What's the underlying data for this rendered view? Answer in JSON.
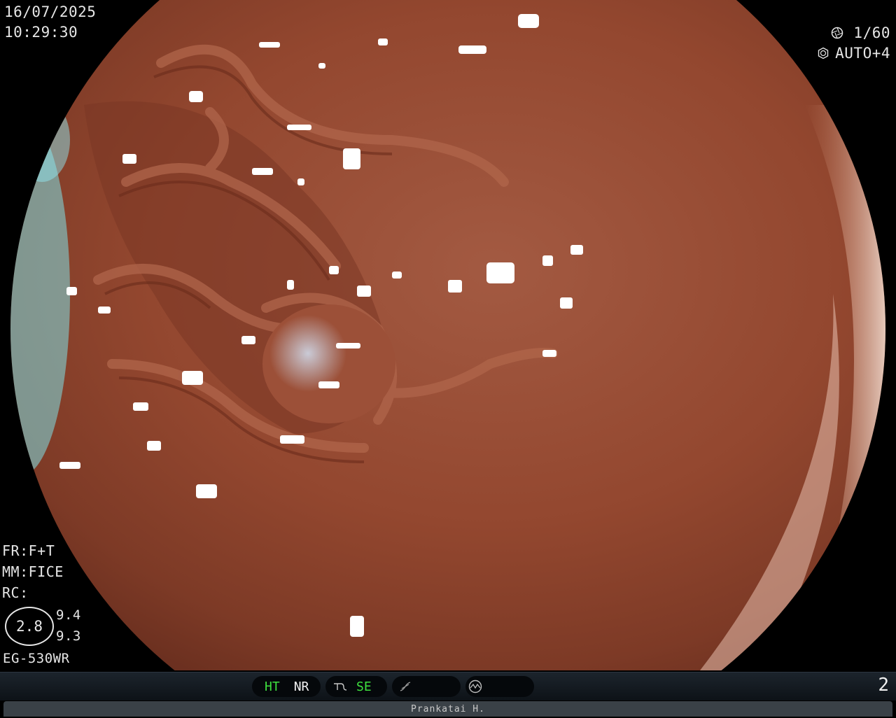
{
  "datetime": {
    "date": "16/07/2025",
    "time": "10:29:30"
  },
  "camera": {
    "shutter": "1/60",
    "iris": "AUTO+4"
  },
  "settings": {
    "fr": "FR:F+T",
    "mm": "MM:FICE",
    "rc": "RC:",
    "zoom": "2.8",
    "value_top": "9.4",
    "value_bottom": "9.3",
    "scope_model": "EG-530WR"
  },
  "statusbar": {
    "ht": "HT",
    "nr": "NR",
    "se": "SE",
    "page_number": "2"
  },
  "footer": {
    "operator": "Prankatai H."
  },
  "colors": {
    "status_green": "#3ee03e",
    "tissue": "#9a4c35"
  },
  "icons": [
    "shutter-icon",
    "iris-icon",
    "enhance-icon",
    "curve-icon",
    "waveform-icon"
  ]
}
